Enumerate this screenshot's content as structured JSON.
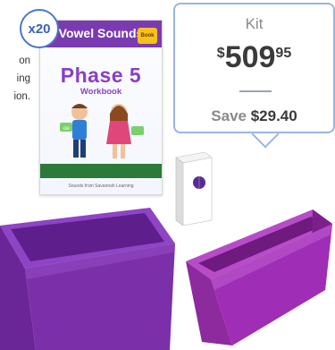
{
  "left_text": [
    "on",
    "ing",
    "ion."
  ],
  "count_badge": "x20",
  "workbook": {
    "banner_title": "Vowel Sounds",
    "badge_text": "Book",
    "title": "Phase 5",
    "subtitle": "Workbook",
    "author": "Sounds from Savannah Learning"
  },
  "price_box": {
    "label": "Kit",
    "currency": "$",
    "dollars": "509",
    "cents": "95",
    "save_label": "Save",
    "save_amount": "$29.40"
  },
  "colors": {
    "accent_blue": "#4a77c9",
    "box_border": "#9bb5dd",
    "bin_purple": "#7b2fa8",
    "bin_magenta": "#a02db5"
  },
  "icons": [
    "dispenser-box-icon",
    "purple-bin-icon",
    "magenta-bin-icon"
  ]
}
